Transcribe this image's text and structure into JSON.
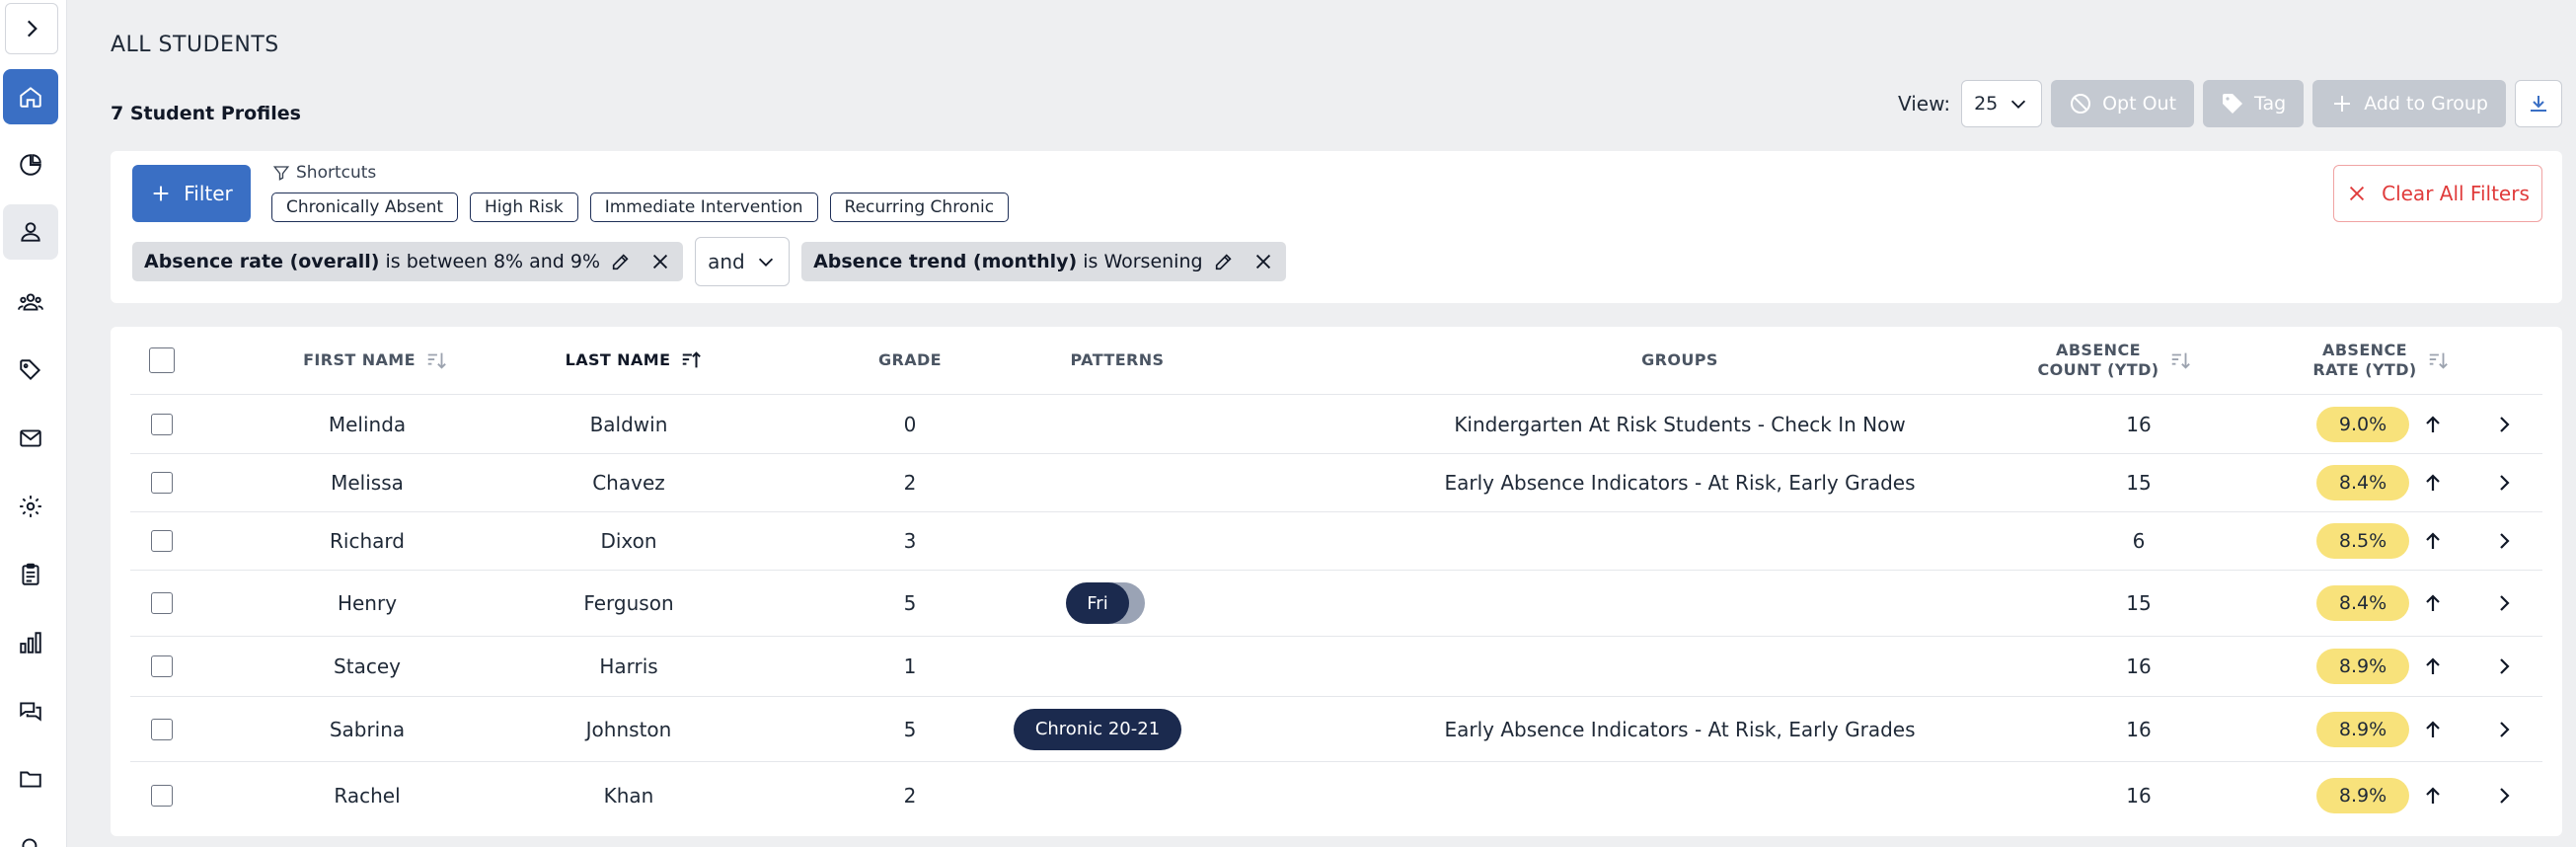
{
  "header": {
    "title": "ALL STUDENTS",
    "profiles_count": "7 Student Profiles"
  },
  "toolbar": {
    "view_label": "View:",
    "view_value": "25",
    "opt_out_label": "Opt Out",
    "tag_label": "Tag",
    "add_to_group_label": "Add to Group"
  },
  "filters": {
    "filter_button_label": "Filter",
    "shortcuts_label": "Shortcuts",
    "shortcuts": [
      "Chronically Absent",
      "High Risk",
      "Immediate Intervention",
      "Recurring Chronic"
    ],
    "clear_label": "Clear All Filters",
    "condition1": {
      "field": "Absence rate (overall)",
      "rest": " is between 8% and 9%"
    },
    "joiner": "and",
    "condition2": {
      "field": "Absence trend (monthly)",
      "rest": " is Worsening"
    }
  },
  "table": {
    "headers": {
      "first_name": "FIRST NAME",
      "last_name": "LAST NAME",
      "grade": "GRADE",
      "patterns": "PATTERNS",
      "groups": "GROUPS",
      "absence_count_1": "ABSENCE",
      "absence_count_2": "COUNT (YTD)",
      "absence_rate_1": "ABSENCE",
      "absence_rate_2": "RATE (YTD)"
    },
    "rows": [
      {
        "first": "Melinda",
        "last": "Baldwin",
        "grade": "0",
        "pattern": "",
        "group": "Kindergarten At Risk Students - Check In Now",
        "count": "16",
        "rate": "9.0%"
      },
      {
        "first": "Melissa",
        "last": "Chavez",
        "grade": "2",
        "pattern": "",
        "group": "Early Absence Indicators - At Risk, Early Grades",
        "count": "15",
        "rate": "8.4%"
      },
      {
        "first": "Richard",
        "last": "Dixon",
        "grade": "3",
        "pattern": "",
        "group": "",
        "count": "6",
        "rate": "8.5%"
      },
      {
        "first": "Henry",
        "last": "Ferguson",
        "grade": "5",
        "pattern": "Fri",
        "group": "",
        "count": "15",
        "rate": "8.4%"
      },
      {
        "first": "Stacey",
        "last": "Harris",
        "grade": "1",
        "pattern": "",
        "group": "",
        "count": "16",
        "rate": "8.9%"
      },
      {
        "first": "Sabrina",
        "last": "Johnston",
        "grade": "5",
        "pattern": "Chronic 20-21",
        "group": "Early Absence Indicators - At Risk, Early Grades",
        "count": "16",
        "rate": "8.9%"
      },
      {
        "first": "Rachel",
        "last": "Khan",
        "grade": "2",
        "pattern": "",
        "group": "",
        "count": "16",
        "rate": "8.9%"
      }
    ]
  },
  "colors": {
    "primary": "#3a6fc4",
    "navy_pill": "#1b2a4e",
    "rate_pill": "#f8e27b",
    "danger": "#e03b3b",
    "disabled_button": "#c4c9d1"
  }
}
